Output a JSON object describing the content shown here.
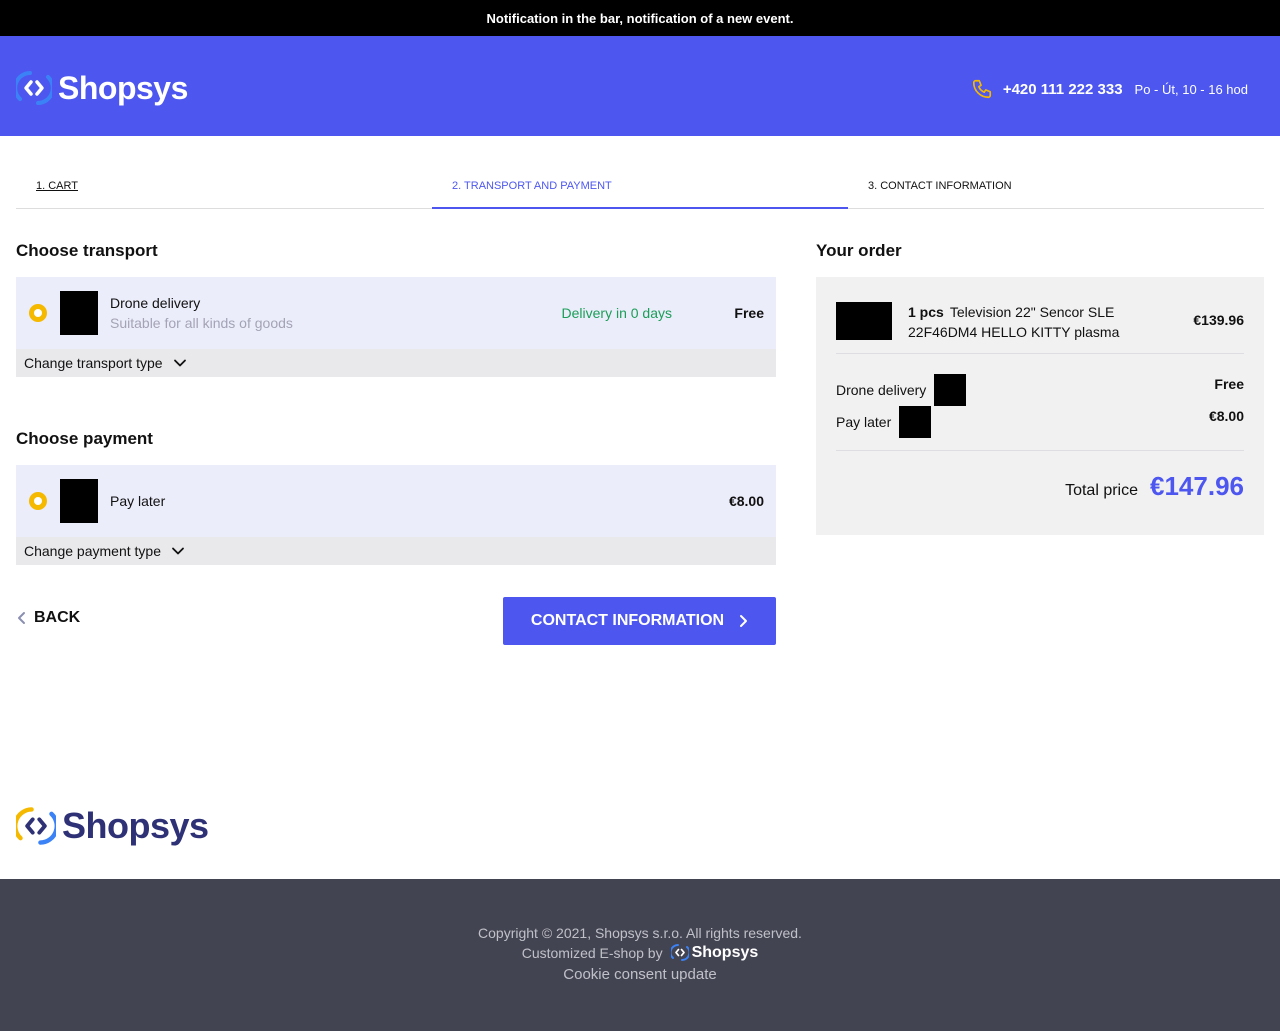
{
  "notification": {
    "text": "Notification in the bar, notification of a new event."
  },
  "header": {
    "logo_text": "Shopsys",
    "phone": "+420 111 222 333",
    "hours": "Po - Út, 10 - 16 hod",
    "bg_color": "#4d57f0"
  },
  "steps": [
    {
      "label": "1. Cart"
    },
    {
      "label": "2. Transport and payment"
    },
    {
      "label": "3. Contact information"
    }
  ],
  "transport": {
    "title": "Choose transport",
    "option": {
      "name": "Drone delivery",
      "description": "Suitable for all kinds of goods",
      "delivery_time": "Delivery in 0 days",
      "price": "Free"
    },
    "change_label": "Change transport type"
  },
  "payment": {
    "title": "Choose payment",
    "option": {
      "name": "Pay later",
      "price": "€8.00"
    },
    "change_label": "Change payment type"
  },
  "nav": {
    "back_label": "Back",
    "next_label": "Contact information"
  },
  "order": {
    "title": "Your order",
    "item": {
      "quantity": "1 pcs",
      "name": "Television 22\" Sencor SLE 22F46DM4 HELLO KITTY plasma",
      "price": "€139.96"
    },
    "transport_name": "Drone delivery",
    "transport_price": "Free",
    "payment_name": "Pay later",
    "payment_price": "€8.00",
    "total_label": "Total price",
    "total_value": "€147.96"
  },
  "footer": {
    "logo_text": "Shopsys",
    "copyright": "Copyright © 2021, Shopsys s.r.o. All rights reserved.",
    "customized": "Customized E-shop by",
    "customized_logo": "Shopsys",
    "cookie": "Cookie consent update"
  },
  "icons": {
    "logo": "shopsys-logo-icon",
    "phone": "phone-icon",
    "chevron_down": "chevron-down-icon",
    "chevron_left": "chevron-left-icon",
    "chevron_right": "chevron-right-icon"
  },
  "colors": {
    "accent": "#4d57f0",
    "radio": "#f5b900",
    "success": "#1b9e58",
    "footer_bg": "#434451"
  }
}
